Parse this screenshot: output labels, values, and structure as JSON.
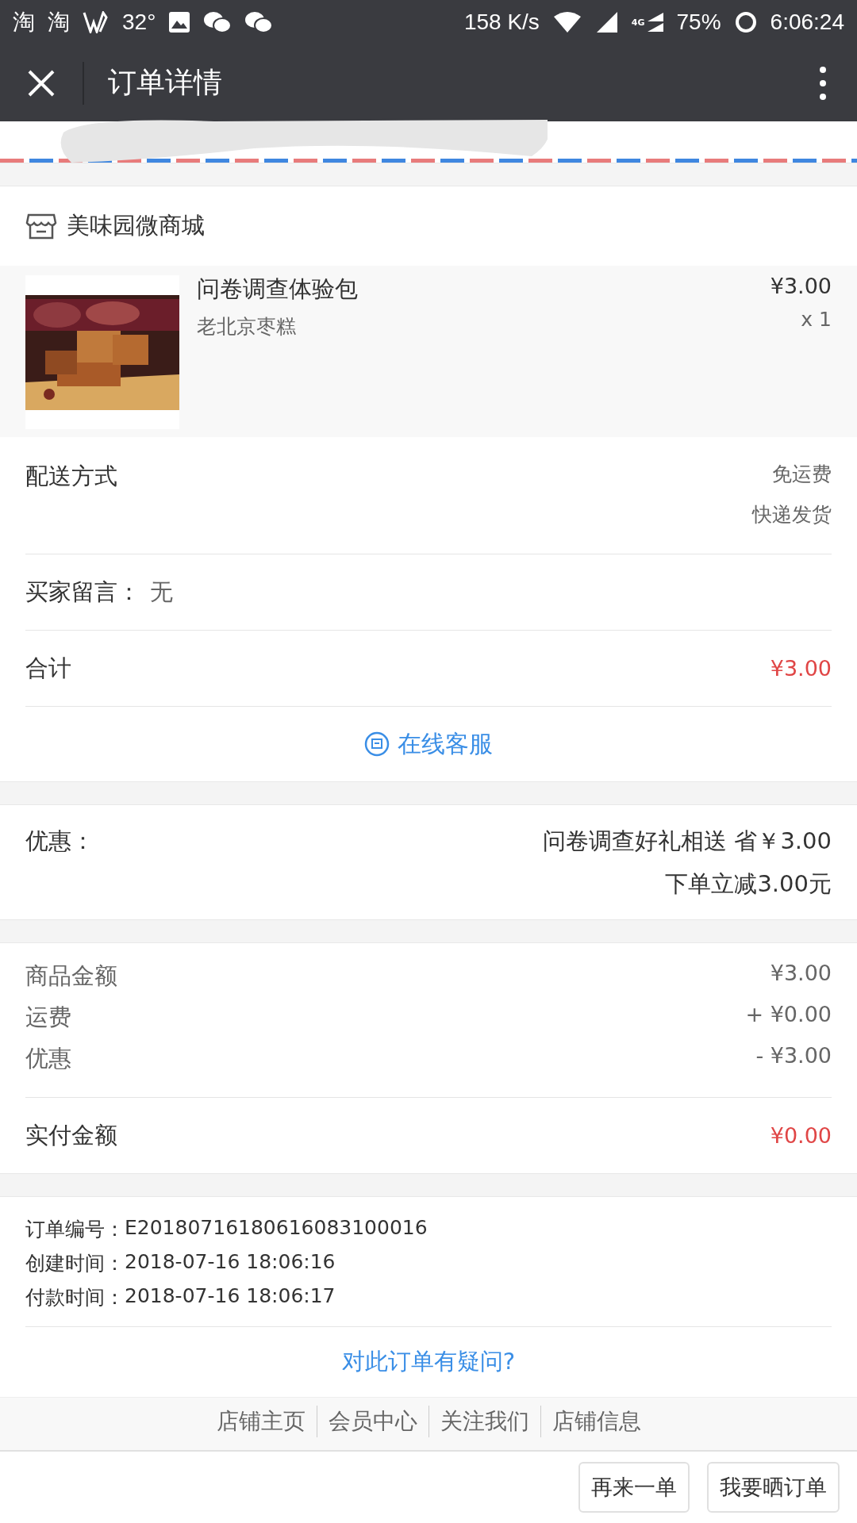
{
  "status_bar": {
    "left": [
      "淘",
      "淘"
    ],
    "temperature": "32°",
    "speed": "158 K/s",
    "network": "4G",
    "battery": "75%",
    "time": "6:06:24"
  },
  "header": {
    "title": "订单详情"
  },
  "shop": {
    "name": "美味园微商城"
  },
  "product": {
    "kind": "picture",
    "name": "问卷调查体验包",
    "spec": "老北京枣糕",
    "price": "¥3.00",
    "quantity": "x 1"
  },
  "delivery": {
    "label": "配送方式",
    "fee": "免运费",
    "method": "快递发货"
  },
  "note": {
    "label": "买家留言：",
    "value": "无"
  },
  "total": {
    "label": "合计",
    "value": "¥3.00"
  },
  "service": {
    "label": "在线客服"
  },
  "discount": {
    "label": "优惠：",
    "lines": [
      "问卷调查好礼相送 省￥3.00",
      "下单立减3.00元"
    ]
  },
  "amounts": [
    {
      "label": "商品金额",
      "value": "¥3.00"
    },
    {
      "label": "运费",
      "value": "+ ¥0.00"
    },
    {
      "label": "优惠",
      "value": "- ¥3.00"
    }
  ],
  "paid": {
    "label": "实付金额",
    "value": "¥0.00"
  },
  "order_info": [
    {
      "label": "订单编号：",
      "value": "E20180716180616083100016"
    },
    {
      "label": "创建时间：",
      "value": "2018-07-16 18:06:16"
    },
    {
      "label": "付款时间：",
      "value": "2018-07-16 18:06:17"
    }
  ],
  "question_link": "对此订单有疑问?",
  "footer_links": [
    "店铺主页",
    "会员中心",
    "关注我们",
    "店铺信息"
  ],
  "buttons": [
    "再来一单",
    "我要晒订单"
  ]
}
